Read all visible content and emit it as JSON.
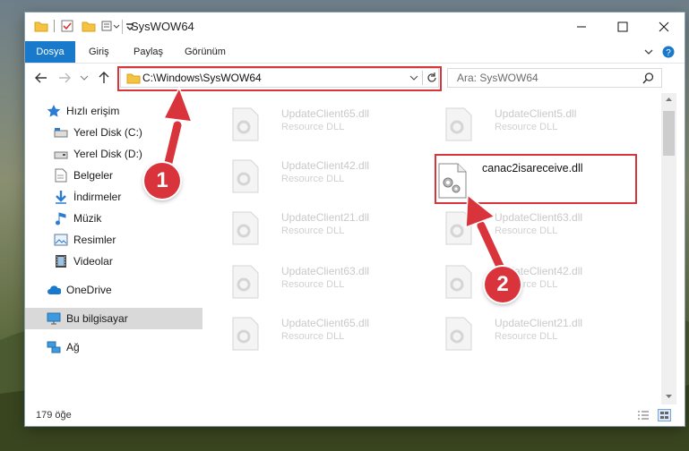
{
  "window": {
    "title": "SysWOW64"
  },
  "ribbon": {
    "tabs": [
      "Dosya",
      "Giriş",
      "Paylaş",
      "Görünüm"
    ]
  },
  "address": {
    "path": "C:\\Windows\\SysWOW64"
  },
  "search": {
    "placeholder": "Ara: SysWOW64"
  },
  "sidebar": {
    "items": [
      {
        "label": "Hızlı erişim",
        "icon": "star-icon"
      },
      {
        "label": "Yerel Disk (C:)",
        "icon": "drive-icon"
      },
      {
        "label": "Yerel Disk (D:)",
        "icon": "drive-icon"
      },
      {
        "label": "Belgeler",
        "icon": "documents-icon"
      },
      {
        "label": "İndirmeler",
        "icon": "download-icon"
      },
      {
        "label": "Müzik",
        "icon": "music-icon"
      },
      {
        "label": "Resimler",
        "icon": "pictures-icon"
      },
      {
        "label": "Videolar",
        "icon": "videos-icon"
      },
      {
        "label": "OneDrive",
        "icon": "cloud-icon"
      },
      {
        "label": "Bu bilgisayar",
        "icon": "computer-icon"
      },
      {
        "label": "Ağ",
        "icon": "network-icon"
      }
    ]
  },
  "files": [
    {
      "name": "UpdateClient65.dll",
      "desc": "Resource DLL"
    },
    {
      "name": "UpdateClient5.dll",
      "desc": "Resource DLL"
    },
    {
      "name": "UpdateClient42.dll",
      "desc": "Resource DLL"
    },
    {
      "name": "canac2isareceive.dll",
      "desc": ""
    },
    {
      "name": "UpdateClient21.dll",
      "desc": "Resource DLL"
    },
    {
      "name": "UpdateClient63.dll",
      "desc": "Resource DLL"
    },
    {
      "name": "UpdateClient63.dll",
      "desc": "Resource DLL"
    },
    {
      "name": "UpdateClient42.dll",
      "desc": "Resource DLL"
    },
    {
      "name": "UpdateClient65.dll",
      "desc": "Resource DLL"
    },
    {
      "name": "UpdateClient21.dll",
      "desc": "Resource DLL"
    }
  ],
  "status": {
    "count": "179 öğe"
  },
  "annotations": {
    "step1": "1",
    "step2": "2",
    "color": "#d9343b"
  },
  "colors": {
    "accent": "#1979ca",
    "selected": "#cce8ff",
    "highlight": "#d9343b"
  }
}
